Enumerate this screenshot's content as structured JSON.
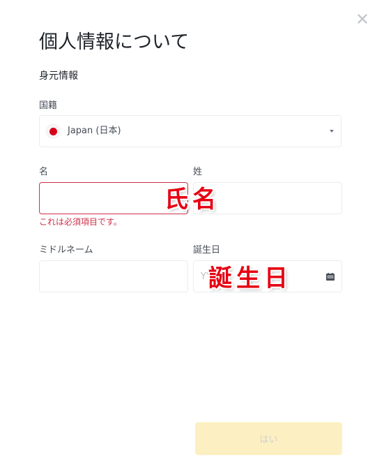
{
  "modal": {
    "title": "個人情報について",
    "section_label": "身元情報"
  },
  "nationality": {
    "label": "国籍",
    "value": "Japan (日本)",
    "flag": "japan-flag-icon",
    "flag_color": "#d7001a"
  },
  "first_name": {
    "label": "名",
    "value": "",
    "error": "これは必須項目です。"
  },
  "last_name": {
    "label": "姓",
    "value": ""
  },
  "middle_name": {
    "label": "ミドルネーム",
    "value": ""
  },
  "birthdate": {
    "label": "誕生日",
    "placeholder": "YY",
    "icon": "calendar-icon"
  },
  "annotations": {
    "name_overlay": "氏名",
    "birthdate_overlay": "誕生日"
  },
  "submit": {
    "label": "はい"
  },
  "colors": {
    "error": "#cf304a",
    "button_disabled_bg": "#fcf0c2",
    "overlay_red": "#e60012"
  }
}
